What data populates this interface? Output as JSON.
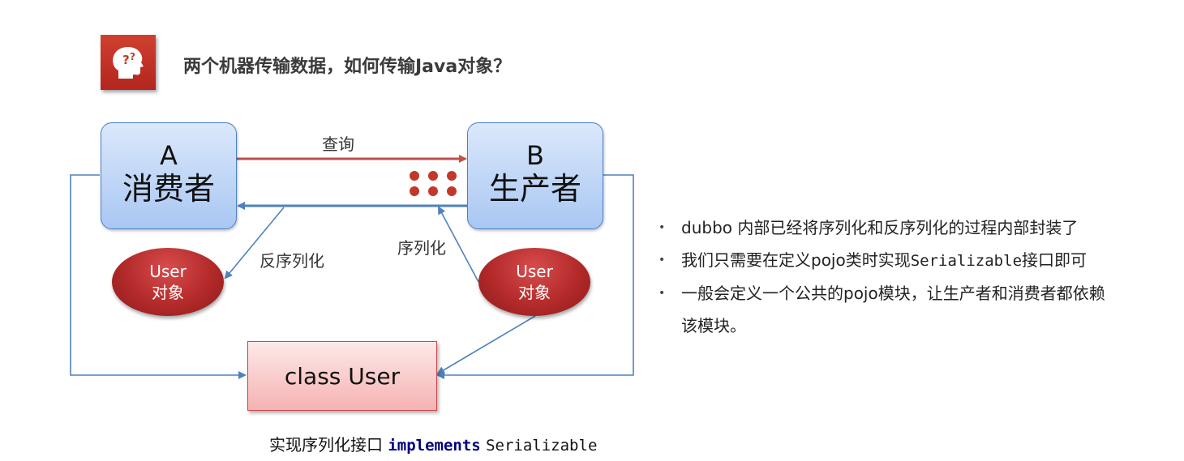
{
  "header": {
    "title": "两个机器传输数据，如何传输Java对象？",
    "icon": "question-head-icon"
  },
  "diagram": {
    "consumer": {
      "letter": "A",
      "role": "消费者"
    },
    "provider": {
      "letter": "B",
      "role": "生产者"
    },
    "query_label": "查询",
    "deserialize_label": "反序列化",
    "serialize_label": "序列化",
    "user_object_a": {
      "line1": "User",
      "line2": "对象"
    },
    "user_object_b": {
      "line1": "User",
      "line2": "对象"
    },
    "class_box": "class User",
    "caption": {
      "prefix": "实现序列化接口",
      "keyword": "implements",
      "interface": "Serializable"
    },
    "colors": {
      "node_border": "#4a7fc8",
      "arrow_red": "#c0504d",
      "arrow_blue": "#4f81bd",
      "dots": "#c0392b"
    }
  },
  "bullets": [
    {
      "text": "dubbo 内部已经将序列化和反序列化的过程内部封装了"
    },
    {
      "before": "我们只需要在定义pojo类时实现",
      "code": "Serializable",
      "after": "接口即可"
    },
    {
      "line1": "一般会定义一个公共的pojo模块，让生产者和消费者都依赖",
      "line2": "该模块。"
    }
  ]
}
